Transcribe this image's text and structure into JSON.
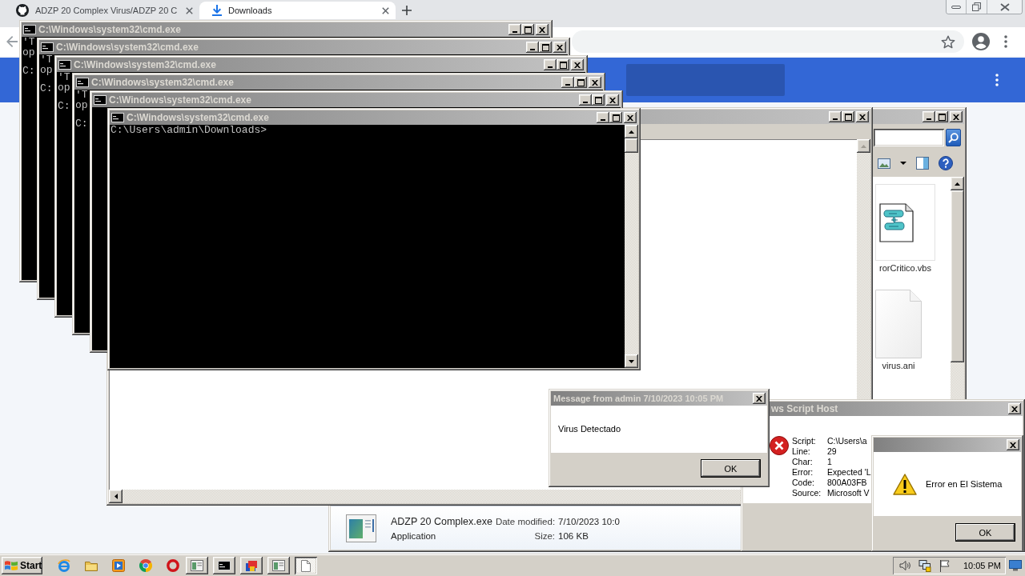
{
  "browser": {
    "tabs": [
      {
        "kind": "site",
        "title": "ADZP 20 Complex Virus/ADZP 20 C",
        "selected": false
      },
      {
        "kind": "downloads",
        "title": "Downloads",
        "selected": true
      }
    ]
  },
  "consoles": [
    {
      "title": "C:\\Windows\\system32\\cmd.exe",
      "output": [
        "'T",
        "op"
      ],
      "prompt": "C:"
    },
    {
      "title": "C:\\Windows\\system32\\cmd.exe",
      "output": [
        "'T",
        "op"
      ],
      "prompt": "C:"
    },
    {
      "title": "C:\\Windows\\system32\\cmd.exe",
      "output": [
        "'T",
        "op"
      ],
      "prompt": "C:"
    },
    {
      "title": "C:\\Windows\\system32\\cmd.exe",
      "output": [
        "'T",
        "op"
      ],
      "prompt": "C:"
    },
    {
      "title": "C:\\Windows\\system32\\cmd.exe"
    },
    {
      "title": "C:\\Windows\\system32\\cmd.exe",
      "prompt": "C:\\Users\\admin\\Downloads>"
    }
  ],
  "explorer": {
    "files": [
      {
        "kind": "script",
        "name": "rorCritico.vbs"
      },
      {
        "kind": "blank",
        "name": "virus.ani"
      }
    ],
    "details": {
      "name": "ADZP 20 Complex.exe",
      "type": "Application",
      "fields": [
        {
          "label": "Date modified:",
          "value": "7/10/2023 10:0"
        },
        {
          "label": "Size:",
          "value": "106 KB"
        }
      ]
    }
  },
  "message_box": {
    "title": "Message from admin 7/10/2023 10:05 PM",
    "text": "Virus Detectado",
    "button": "OK"
  },
  "script_error": {
    "title": "ws Script Host",
    "fields": [
      {
        "label": "Script:",
        "value": "C:\\Users\\a"
      },
      {
        "label": "Line:",
        "value": "29"
      },
      {
        "label": "Char:",
        "value": "1"
      },
      {
        "label": "Error:",
        "value": "Expected 'L"
      },
      {
        "label": "Code:",
        "value": "800A03FB"
      },
      {
        "label": "Source:",
        "value": "Microsoft V"
      }
    ]
  },
  "alert": {
    "text": "Error en El Sistema",
    "button": "OK"
  },
  "taskbar": {
    "start": "Start",
    "tasks": [
      {
        "kind": "window",
        "selected": false
      },
      {
        "kind": "console",
        "selected": false
      },
      {
        "kind": "app",
        "selected": false
      },
      {
        "kind": "window",
        "selected": false
      },
      {
        "kind": "document",
        "selected": true
      }
    ],
    "clock": "10:05 PM"
  }
}
